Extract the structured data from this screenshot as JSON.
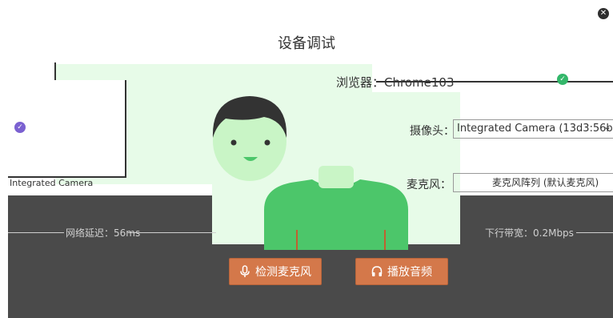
{
  "title": "设备调试",
  "browser": {
    "label": "浏览器：",
    "value": "Chrome103"
  },
  "camera": {
    "label": "摄像头：",
    "value": "Integrated Camera (13d3:56b"
  },
  "microphone": {
    "label": "麦克风：",
    "value": "麦克风阵列 (默认麦克风)"
  },
  "left_device": "Integrated Camera",
  "latency": "网络延迟：56ms",
  "bandwidth": "下行带宽：0.2Mbps",
  "buttons": {
    "test_mic": "检测麦克风",
    "play_audio": "播放音频"
  },
  "colors": {
    "accent": "#d4784a",
    "check_green": "#33b76a",
    "check_purple": "#7b61d1",
    "shirt": "#4cc66a",
    "skin": "#c9f5c6"
  }
}
